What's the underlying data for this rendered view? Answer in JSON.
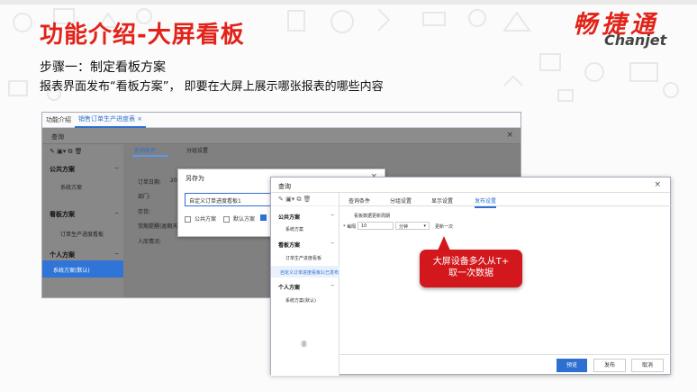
{
  "slide": {
    "title": "功能介绍-大屏看板",
    "step": "步骤一：制定看板方案",
    "description": "报表界面发布“看板方案”， 即要在大屏上展示哪张报表的哪些内容",
    "logo_cn": "畅捷通",
    "logo_en": "Chanjet",
    "accent_color": "#e2231a"
  },
  "screenshot1": {
    "tabs": [
      "功能介绍",
      "销售订单生产进度表"
    ],
    "dialog_title": "查询",
    "close": "×",
    "sidebar": {
      "public": "公共方案",
      "public_item": "系统方案",
      "board": "看板方案",
      "board_item": "订单生产进度看板",
      "personal": "个人方案",
      "personal_item": "系统方案(默认)",
      "collapse": "−"
    },
    "tabs_inner": [
      "查询条件",
      "分组设置"
    ],
    "fields": [
      "订单日期:",
      "部门:",
      "存货:",
      "货期提醒(逾期天",
      "人库情况:"
    ],
    "date_partial": "20",
    "save_as": {
      "title": "另存为",
      "close": "×",
      "name_value": "自定义订单进度看板1",
      "options": [
        "公共方案",
        "默认方案"
      ]
    }
  },
  "screenshot2": {
    "title": "查询",
    "close": "×",
    "sidebar": {
      "public": "公共方案",
      "public_item": "系统方案",
      "board": "看板方案",
      "board_item1": "订单生产进度看板",
      "board_item2": "自定义订单进度看板1(已发布)",
      "personal": "个人方案",
      "personal_item": "系统方案(默认)",
      "collapse": "−",
      "help": "⓪"
    },
    "tabs": [
      "查询条件",
      "分组设置",
      "显示设置",
      "发布设置"
    ],
    "section": "看板数据更新周期",
    "interval_label": "* 每隔",
    "interval_value": "10",
    "unit": "分钟",
    "suffix": "更新一次",
    "buttons": {
      "preview": "预览",
      "publish": "发布",
      "cancel": "取消"
    }
  },
  "callout": {
    "line1": "大屏设备多久从T+",
    "line2": "取一次数据"
  }
}
